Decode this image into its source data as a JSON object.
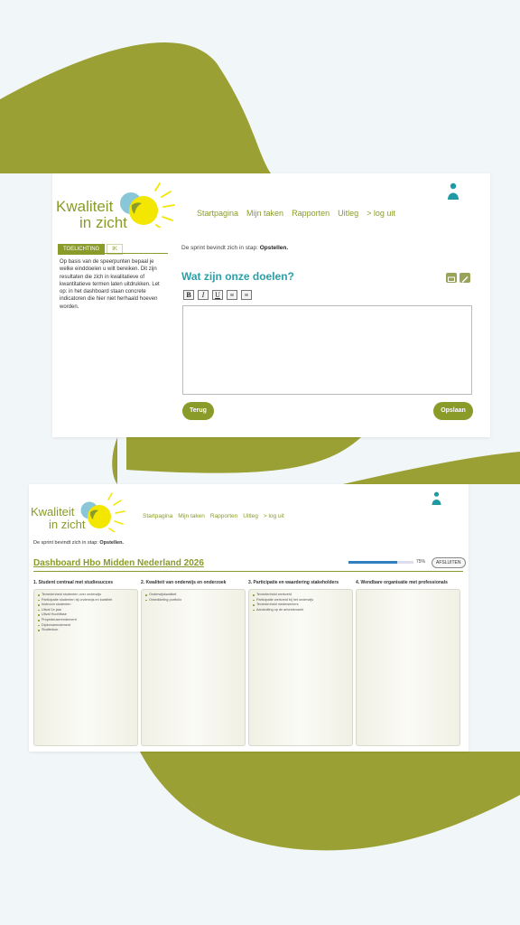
{
  "colors": {
    "brand_green": "#8a9b2a",
    "teal": "#2aa0a8",
    "background_blob": "#9aa033",
    "progress_blue": "#2f7fc1"
  },
  "logo": {
    "line1": "Kwaliteit",
    "line2": "in zicht"
  },
  "nav": [
    "Startpagina",
    "Mijn taken",
    "Rapporten",
    "Uitleg",
    "> log uit"
  ],
  "user_icon": "user-icon",
  "screen1": {
    "tabs": [
      "TOELICHTING",
      "IK"
    ],
    "side_text": "Op basis van de speerpunten bepaal je welke einddoelen u wilt bereiken. Dit zijn resultaten die zich in kwalitatieve of kwantitatieve termen laten uitdrukken. Let op: in het dashboard staan concrete indicatoren die hier niet herhaald hoeven worden.",
    "sprint_prefix": "De sprint bevindt zich in stap: ",
    "sprint_step": "Opstellen.",
    "title": "Wat zijn onze doelen?",
    "toolbar": [
      "B",
      "I",
      "U",
      "≡",
      "≡"
    ],
    "buttons": {
      "back": "Terug",
      "save": "Opslaan"
    }
  },
  "screen2": {
    "sprint_prefix": "De sprint bevindt zich in stap: ",
    "sprint_step": "Opstellen.",
    "dashboard_title": "Dashboard Hbo Midden Nederland 2026",
    "progress": {
      "percent": 75,
      "label": "75%"
    },
    "close_button": "AFSLUITEN",
    "columns": [
      {
        "title": "1. Student centraal met studiesucces",
        "items": [
          "Tevredenheid studenten over onderwijs",
          "Participatie studenten bij onderwijs en kwaliteit",
          "Instroom studenten",
          "Uitval 1e jaar",
          "Uitval Hoofdfase",
          "Propedeuserendement",
          "Diplomarendement",
          "Studieduur"
        ]
      },
      {
        "title": "2. Kwaliteit van onderwijs en onderzoek",
        "items": [
          "Onderwijskwaliteit",
          "Ontwikkeling portfolio"
        ]
      },
      {
        "title": "3. Participatie en waardering stakeholders",
        "items": [
          "Tevredenheid werkveld",
          "Participatie werkveld bij het onderwijs",
          "Tevredenheid medewerkers",
          "Aansluiting op de arbeidsmarkt"
        ]
      },
      {
        "title": "4. Wendbare organisatie met professionals",
        "items": []
      }
    ]
  }
}
